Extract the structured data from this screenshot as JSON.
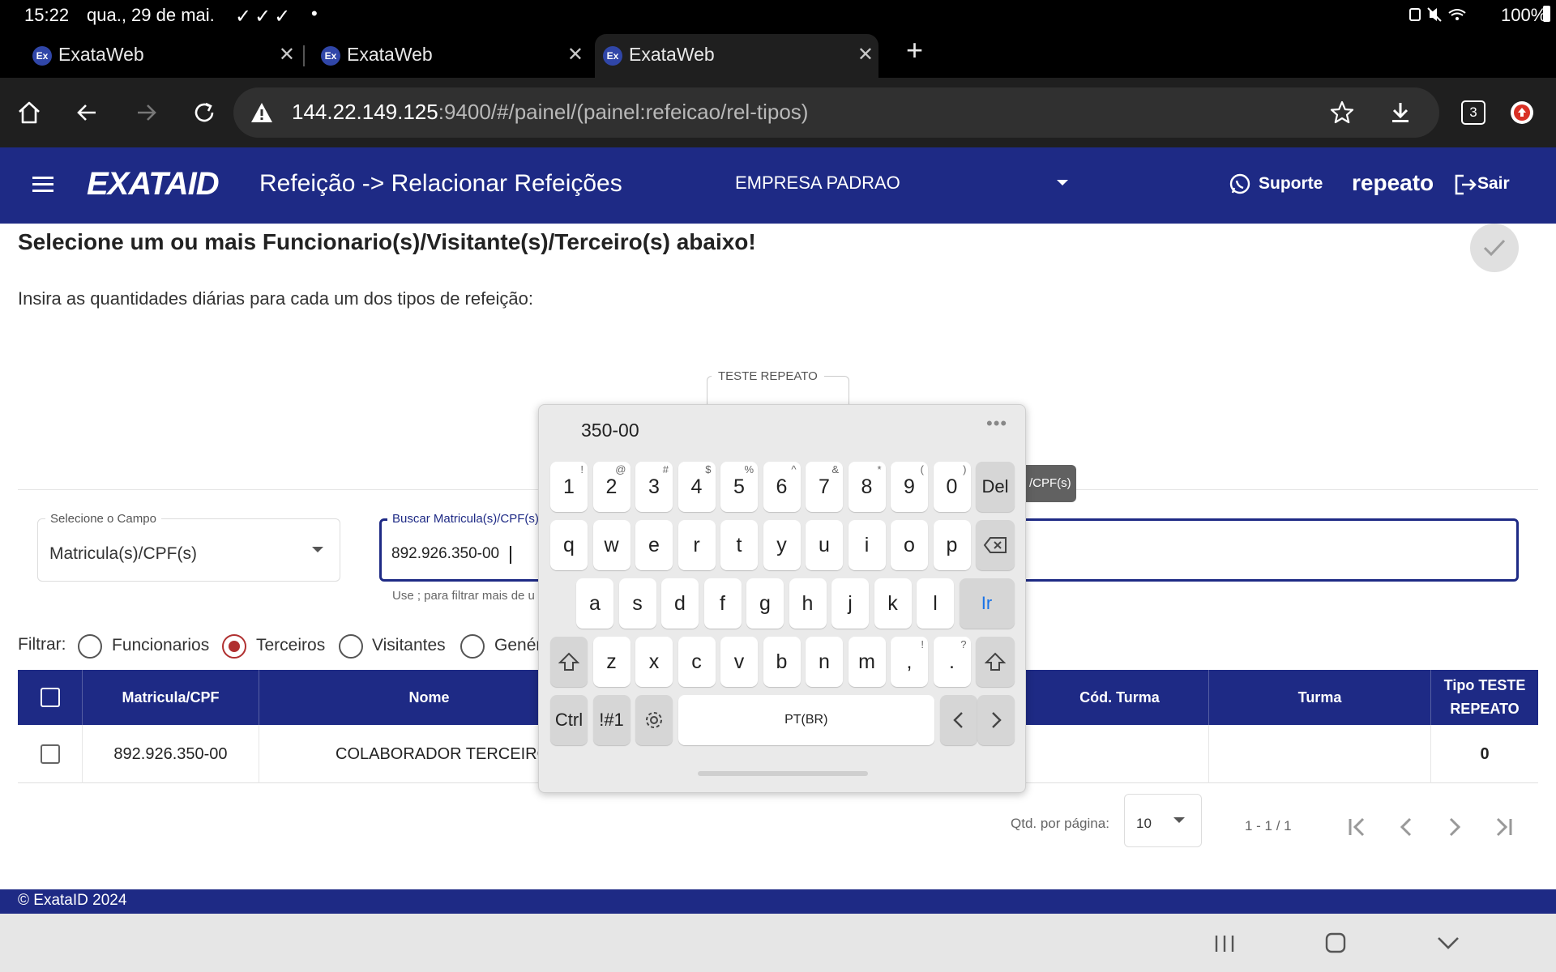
{
  "status_bar": {
    "time": "15:22",
    "date": "qua., 29 de mai.",
    "checks": "✓✓✓",
    "dot": "•",
    "battery": "100%"
  },
  "browser": {
    "tabs": [
      {
        "favicon": "Ex",
        "title": "ExataWeb"
      },
      {
        "favicon": "Ex",
        "title": "ExataWeb"
      },
      {
        "favicon": "Ex",
        "title": "ExataWeb"
      }
    ],
    "url_host": "144.22.149.125",
    "url_rest": ":9400/#/painel/(painel:refeicao/rel-tipos)",
    "tab_count": "3"
  },
  "header": {
    "logo": "EXATAID",
    "title": "Refeição -> Relacionar Refeições",
    "empresa": "EMPRESA PADRAO",
    "suporte": "Suporte",
    "user": "repeato",
    "sair": "Sair"
  },
  "main": {
    "heading": "Selecione um ou mais Funcionario(s)/Visitante(s)/Terceiro(s) abaixo!",
    "instruction": "Insira as quantidades diárias para cada um dos tipos de refeição:",
    "meal_type_label": "TESTE REPEATO"
  },
  "search": {
    "field_label": "Selecione o Campo",
    "field_value": "Matricula(s)/CPF(s)",
    "input_label": "Buscar Matricula(s)/CPF(s)",
    "input_value": "892.926.350-00",
    "hint": "Use ; para filtrar mais de u",
    "tooltip": "/CPF(s)"
  },
  "filter": {
    "label": "Filtrar:",
    "options": [
      {
        "label": "Funcionarios",
        "checked": false
      },
      {
        "label": "Terceiros",
        "checked": true
      },
      {
        "label": "Visitantes",
        "checked": false
      },
      {
        "label": "Genér",
        "checked": false
      }
    ]
  },
  "table": {
    "headers": [
      "Matricula/CPF",
      "Nome",
      "Cód. Turma",
      "Turma",
      "Tipo TESTE REPEATO"
    ],
    "rows": [
      {
        "matricula": "892.926.350-00",
        "nome": "COLABORADOR TERCEIRO TI",
        "cod_turma": "",
        "turma": "",
        "tipo": "0"
      }
    ]
  },
  "paginator": {
    "label": "Qtd. por página:",
    "page_size": "10",
    "range": "1 - 1 / 1"
  },
  "footer": {
    "copyright": "© ExataID 2024"
  },
  "keyboard": {
    "suggestion": "350-00",
    "more": "•••",
    "row1": [
      [
        "1",
        "!"
      ],
      [
        "2",
        "@"
      ],
      [
        "3",
        "#"
      ],
      [
        "4",
        "$"
      ],
      [
        "5",
        "%"
      ],
      [
        "6",
        "^"
      ],
      [
        "7",
        "&"
      ],
      [
        "8",
        "*"
      ],
      [
        "9",
        "("
      ],
      [
        "0",
        ")"
      ]
    ],
    "del": "Del",
    "row2": [
      "q",
      "w",
      "e",
      "r",
      "t",
      "y",
      "u",
      "i",
      "o",
      "p"
    ],
    "row3": [
      "a",
      "s",
      "d",
      "f",
      "g",
      "h",
      "j",
      "k",
      "l"
    ],
    "go": "Ir",
    "row4": [
      "z",
      "x",
      "c",
      "v",
      "b",
      "n",
      "m"
    ],
    "comma": [
      ",",
      "!"
    ],
    "period": [
      ".",
      "?"
    ],
    "ctrl": "Ctrl",
    "symbols": "!#1",
    "space": "PT(BR)"
  },
  "colors": {
    "brand": "#1e2a85",
    "radio_selected": "#b03030",
    "status_bar": "#000000",
    "keyboard_go": "#1a73e8"
  }
}
